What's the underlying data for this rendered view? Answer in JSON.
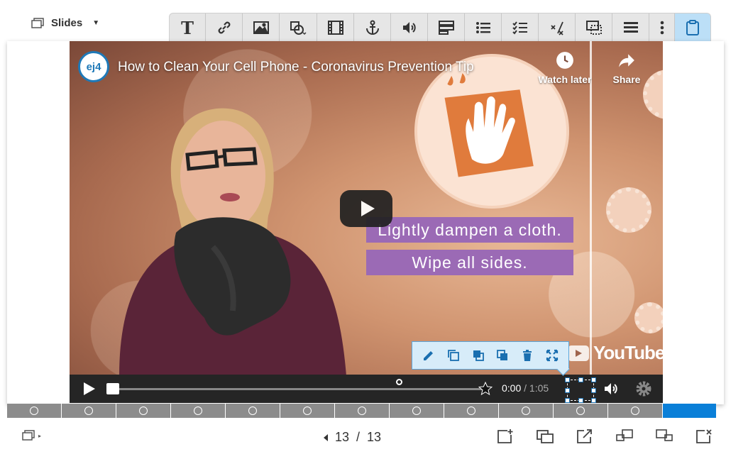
{
  "slides_menu": {
    "label": "Slides"
  },
  "toolbar": {
    "buttons": [
      {
        "name": "text-icon",
        "label": "T"
      },
      {
        "name": "link-icon"
      },
      {
        "name": "image-icon"
      },
      {
        "name": "shape-icon"
      },
      {
        "name": "video-icon"
      },
      {
        "name": "anchor-icon"
      },
      {
        "name": "audio-icon"
      },
      {
        "name": "form-icon"
      },
      {
        "name": "list-icon"
      },
      {
        "name": "checklist-icon"
      },
      {
        "name": "math-icon"
      },
      {
        "name": "overlay-icon"
      },
      {
        "name": "table-icon"
      },
      {
        "name": "more-icon"
      },
      {
        "name": "clipboard-icon"
      }
    ]
  },
  "video": {
    "channel_logo": "ej4",
    "title": "How to Clean Your Cell Phone - Coronavirus Prevention Tip",
    "watch_later": "Watch later",
    "share": "Share",
    "caption_1": "Lightly dampen a cloth.",
    "caption_2": "Wipe all sides.",
    "youtube_brand": "YouTube",
    "time_current": "0:00",
    "time_separator": " / ",
    "time_total": "1:05",
    "progress": 0.0
  },
  "edit_tools": [
    "edit-icon",
    "duplicate-icon",
    "bring-forward-icon",
    "send-backward-icon",
    "delete-icon",
    "fullscreen-icon"
  ],
  "slide_strip": {
    "count": 13,
    "current": 13
  },
  "pager": {
    "current": "13",
    "separator": "/",
    "total": "13"
  },
  "bottom_actions": [
    "add-slide-icon",
    "duplicate-slide-icon",
    "export-slide-icon",
    "move-left-icon",
    "move-right-icon",
    "delete-slide-icon"
  ],
  "colors": {
    "accent": "#0a7fd8",
    "caption_bg": "#9b6ab5",
    "toolbar_bg": "#e6e6e6",
    "active_tool": "#bcdff7"
  }
}
